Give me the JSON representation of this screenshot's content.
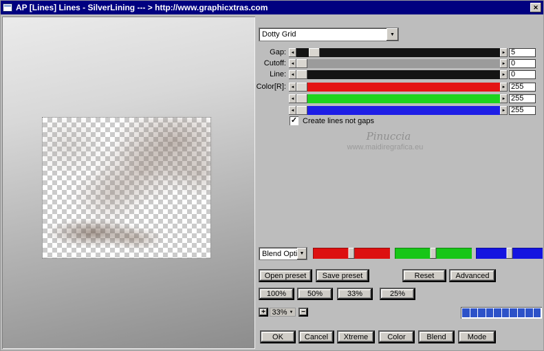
{
  "window": {
    "title": "AP [Lines]  Lines - SilverLining    --- > http://www.graphicxtras.com",
    "titlebar_color": "#000080"
  },
  "icons": {
    "close": "✕",
    "check": "✓",
    "down_arrow": "▼",
    "left_arrow": "◄",
    "right_arrow": "►"
  },
  "preset_dropdown": {
    "value": "Dotty Grid"
  },
  "sliders": [
    {
      "label": "Gap:",
      "value": "5",
      "color": "#141414",
      "thumb_left": "6%"
    },
    {
      "label": "Cutoff:",
      "value": "0",
      "color": "#9b9b9b",
      "thumb_left": "0%"
    },
    {
      "label": "Line:",
      "value": "0",
      "color": "#141414",
      "thumb_left": "0%"
    },
    {
      "label": "Color[R]:",
      "value": "255",
      "color": "#e41414",
      "thumb_left": "0%"
    },
    {
      "label": "",
      "value": "255",
      "color": "#1ed31e",
      "thumb_left": "0%"
    },
    {
      "label": "",
      "value": "255",
      "color": "#1e1ee6",
      "thumb_left": "0%"
    }
  ],
  "checkbox": {
    "label": "Create lines not gaps",
    "checked": true
  },
  "watermark": {
    "line1": "Pinuccia",
    "line2": "www.maidiregrafica.eu"
  },
  "blend": {
    "dropdown_value": "Blend Opti",
    "sliders": [
      {
        "name": "red",
        "color": "#dd1010",
        "thumb_left": "50%"
      },
      {
        "name": "green",
        "color": "#17c617",
        "thumb_left": "50%"
      },
      {
        "name": "blue",
        "color": "#1414e0",
        "thumb_left": "50%"
      }
    ]
  },
  "preset_buttons": [
    "Open preset",
    "Save preset",
    "Reset",
    "Advanced"
  ],
  "zoom_buttons": [
    "100%",
    "50%",
    "33%",
    "25%"
  ],
  "zoom_control": {
    "plus": "+",
    "value": "33%",
    "minus": "−"
  },
  "progress": {
    "segments": 10,
    "color": "#2d52c8"
  },
  "bottom_buttons": [
    "OK",
    "Cancel",
    "Xtreme",
    "Color",
    "Blend",
    "Mode"
  ]
}
